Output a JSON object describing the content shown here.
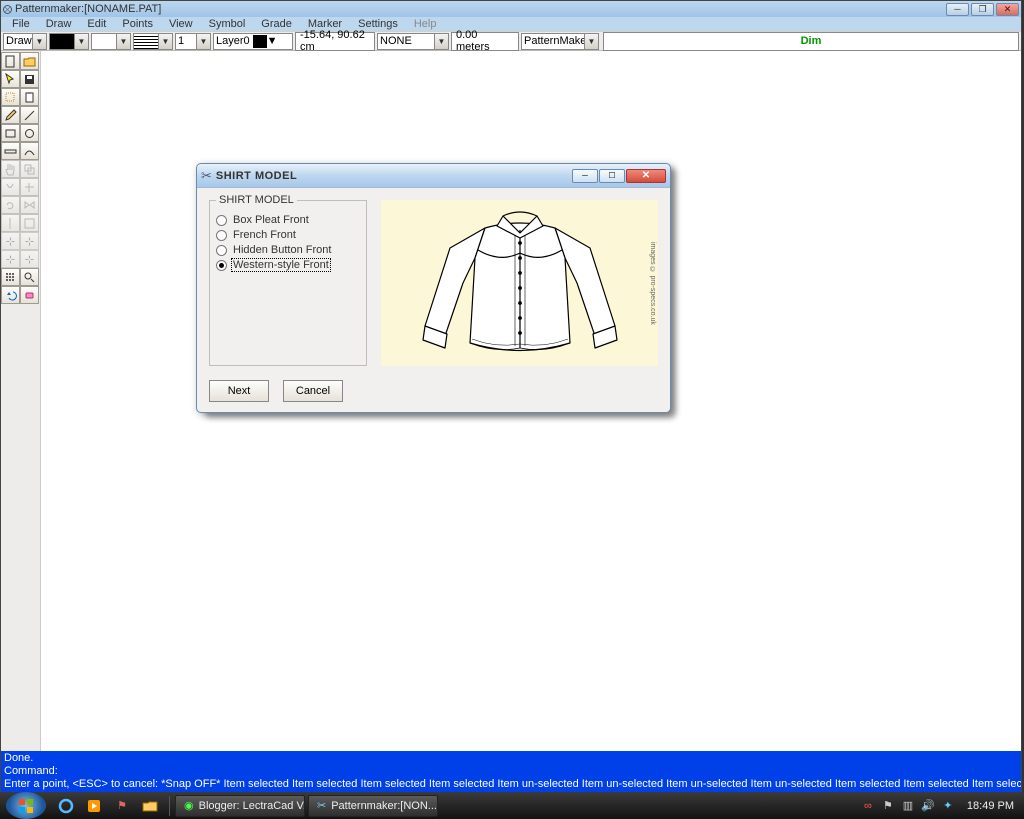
{
  "window": {
    "title": "Patternmaker:[NONAME.PAT]",
    "min_label": "─",
    "restore_label": "❐",
    "close_label": "✕"
  },
  "menu": {
    "items": [
      "File",
      "Draw",
      "Edit",
      "Points",
      "View",
      "Symbol",
      "Grade",
      "Marker",
      "Settings",
      "Help"
    ]
  },
  "propbar": {
    "draw": "Draw",
    "line_width": "1",
    "layer": "Layer0",
    "coords": "-15.64, 90.62 cm",
    "units_combo": "NONE",
    "meters": "0.00 meters",
    "app_combo": "PatternMaker",
    "dim": "Dim"
  },
  "tools": {
    "names": [
      [
        "new-doc",
        "open-doc"
      ],
      [
        "select-arrow",
        "save"
      ],
      [
        "lasso",
        "clipboard"
      ],
      [
        "pencil",
        "line"
      ],
      [
        "rectangle",
        "ellipse"
      ],
      [
        "ruler",
        "curve"
      ],
      [
        "hand",
        "duplicate"
      ],
      [
        "cup",
        "flip"
      ],
      [
        "rotate",
        "mirror"
      ],
      [
        "cut-v",
        "snap"
      ],
      [
        "measure-tool",
        "measure-tool2"
      ],
      [
        "measure-tool3",
        "measure-tool4"
      ],
      [
        "grid-tool",
        "zoom"
      ],
      [
        "undo",
        "redo"
      ]
    ]
  },
  "dialog": {
    "title": "SHIRT MODEL",
    "min": "─",
    "max": "☐",
    "close": "✕",
    "group_label": "SHIRT MODEL",
    "options": [
      {
        "label": "Box Pleat Front",
        "selected": false
      },
      {
        "label": "French Front",
        "selected": false
      },
      {
        "label": "Hidden Button Front",
        "selected": false
      },
      {
        "label": "Western-style Front",
        "selected": true
      }
    ],
    "credit": "images © pro-specs.co.uk",
    "next": "Next",
    "cancel": "Cancel"
  },
  "status": {
    "l1": "Done.",
    "l2": "Command:",
    "l3": "Enter a point, <ESC> to cancel:  *Snap OFF*  Item selected Item selected Item selected Item selected Item un-selected Item un-selected Item un-selected Item un-selected Item selected Item selected Item selected Item selected Item s"
  },
  "taskbar": {
    "tasks": [
      {
        "icon": "◉",
        "label": "Blogger: LectraCad V..."
      },
      {
        "icon": "✂",
        "label": "Patternmaker:[NON..."
      }
    ],
    "clock": "18:49 PM"
  }
}
